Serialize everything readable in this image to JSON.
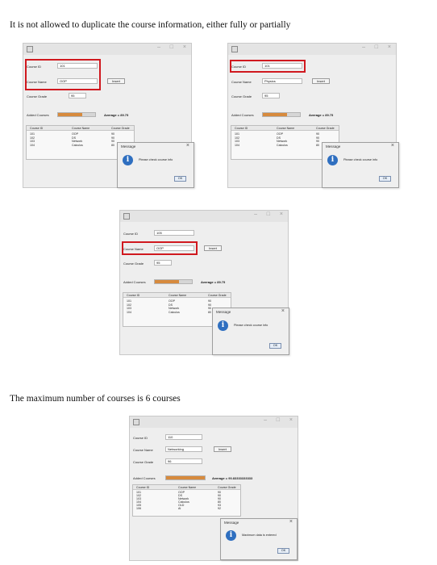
{
  "captions": {
    "top": "It is not allowed to duplicate the course information, either fully or partially",
    "middle": "The maximum number of courses is 6 courses"
  },
  "common": {
    "labels": {
      "course_id": "Course ID",
      "course_name": "Course Name",
      "course_grade": "Course Grade",
      "added_courses": "Added Courses",
      "average": "Average ="
    },
    "insert": "Insert",
    "columns": [
      "Course ID",
      "Course Name",
      "Course Grade"
    ],
    "dialog_title": "Message",
    "ok": "OK",
    "window_controls": [
      "–",
      "□",
      "×"
    ],
    "icons": {
      "app": "app-icon",
      "info": "info-icon"
    },
    "accent": "#d0191f",
    "progress_color": "#d78a3d"
  },
  "windows": [
    {
      "id": "w1",
      "course_id": "101",
      "course_name": "OOP",
      "course_grade": "95",
      "average": "89.75",
      "progress": 0.66,
      "rows": [
        [
          "101",
          "OOP",
          "90"
        ],
        [
          "102",
          "DS",
          "90"
        ],
        [
          "103",
          "Network",
          "90"
        ],
        [
          "104",
          "Calculus",
          "80"
        ]
      ],
      "message": "Please check course info",
      "highlight": [
        "id",
        "name"
      ]
    },
    {
      "id": "w2",
      "course_id": "101",
      "course_name": "Physics",
      "course_grade": "95",
      "average": "89.75",
      "progress": 0.66,
      "rows": [
        [
          "101",
          "OOP",
          "90"
        ],
        [
          "102",
          "DS",
          "90"
        ],
        [
          "103",
          "Network",
          "90"
        ],
        [
          "104",
          "Calculus",
          "80"
        ]
      ],
      "message": "Please check course info",
      "highlight": [
        "id"
      ]
    },
    {
      "id": "w3",
      "course_id": "105",
      "course_name": "OOP",
      "course_grade": "95",
      "average": "89.75",
      "progress": 0.66,
      "rows": [
        [
          "101",
          "OOP",
          "90"
        ],
        [
          "102",
          "DS",
          "90"
        ],
        [
          "103",
          "Network",
          "90"
        ],
        [
          "104",
          "Calculus",
          "80"
        ]
      ],
      "message": "Please check course info",
      "highlight": [
        "name"
      ]
    },
    {
      "id": "w4",
      "course_id": "110",
      "course_name": "Networking",
      "course_grade": "96",
      "average": "90.83333333333",
      "progress": 1.0,
      "rows": [
        [
          "101",
          "OOP",
          "90"
        ],
        [
          "102",
          "DS",
          "90"
        ],
        [
          "103",
          "Network",
          "90"
        ],
        [
          "104",
          "Calculus",
          "80"
        ],
        [
          "105",
          "OLD",
          "93"
        ],
        [
          "106",
          "AI",
          "92"
        ]
      ],
      "message": "Maximum data is entered",
      "highlight": []
    }
  ]
}
